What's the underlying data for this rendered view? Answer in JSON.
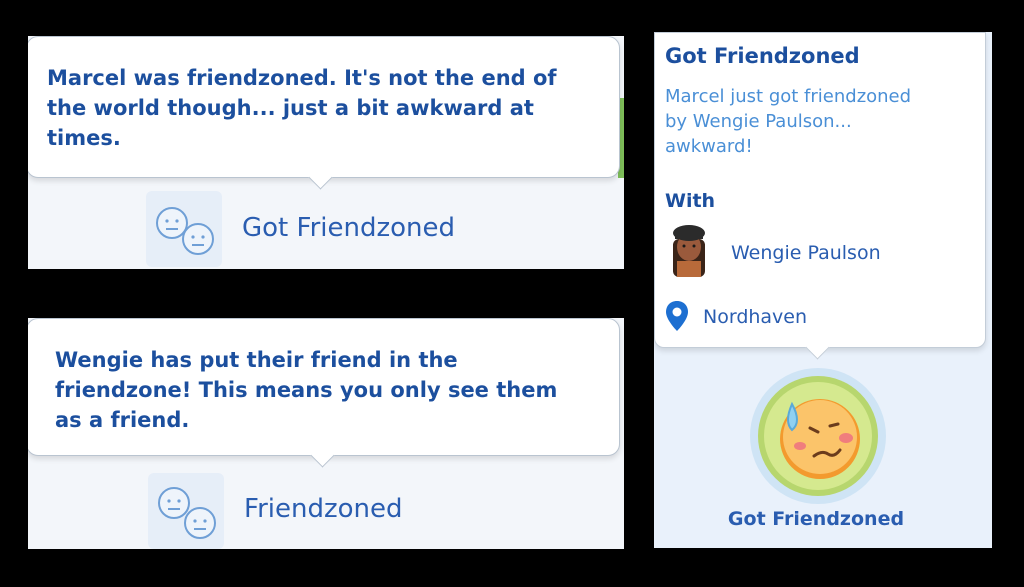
{
  "notif1": {
    "message": [
      "Marcel was friendzoned. It's not the end of",
      "the world though... just a bit awkward at",
      "times."
    ],
    "label": "Got Friendzoned",
    "icon": "two-neutral-faces-icon"
  },
  "notif2": {
    "message": [
      "Wengie has put their friend in the",
      "friendzone! This means you only see them",
      "as a friend."
    ],
    "label": "Friendzoned",
    "icon": "two-neutral-faces-icon"
  },
  "tooltip": {
    "title": "Got Friendzoned",
    "description": [
      "Marcel just got friendzoned",
      "by Wengie Paulson...",
      "awkward!"
    ],
    "with_label": "With",
    "with_name": "Wengie Paulson",
    "location": "Nordhaven",
    "moodlet_label": "Got Friendzoned",
    "moodlet_icon": "awkward-sweating-face-icon"
  },
  "colors": {
    "text_dark_blue": "#1c4f9e",
    "text_light_blue": "#4a8fd6",
    "accent_green": "#7fbf5a",
    "moodlet_orange": "#f39a2e"
  }
}
